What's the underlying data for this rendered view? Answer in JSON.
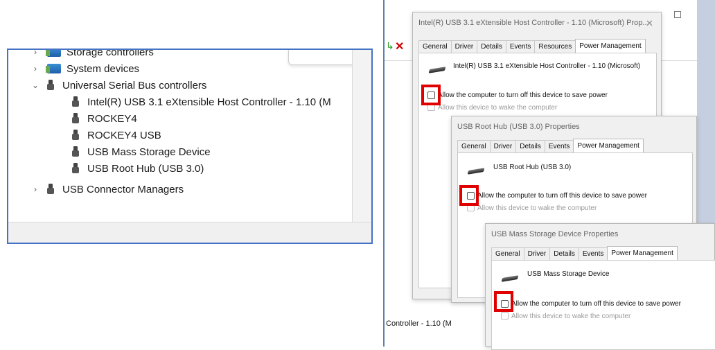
{
  "device_manager": {
    "items": [
      {
        "label": "Storage controllers",
        "icon": "storage-controller-icon",
        "chevron": "collapsed"
      },
      {
        "label": "System devices",
        "icon": "system-devices-icon",
        "chevron": "collapsed"
      },
      {
        "label": "Universal Serial Bus controllers",
        "icon": "usb-icon",
        "chevron": "expanded"
      },
      {
        "label": "Intel(R) USB 3.1 eXtensible Host Controller - 1.10 (M",
        "icon": "usb-icon"
      },
      {
        "label": "ROCKEY4",
        "icon": "usb-icon"
      },
      {
        "label": "ROCKEY4 USB",
        "icon": "usb-icon"
      },
      {
        "label": "USB Mass Storage Device",
        "icon": "usb-icon"
      },
      {
        "label": "USB Root Hub (USB 3.0)",
        "icon": "usb-icon"
      },
      {
        "label": "USB Connector Managers",
        "icon": "usb-icon",
        "chevron": "collapsed"
      }
    ]
  },
  "background_window": {
    "delete_icon": "✕",
    "behind_text": "Controller - 1.10 (M"
  },
  "tabs": [
    "General",
    "Driver",
    "Details",
    "Events",
    "Resources",
    "Power Management"
  ],
  "dialogs": [
    {
      "title": "Intel(R) USB 3.1 eXtensible Host Controller - 1.10 (Microsoft) Prop...",
      "device_name": "Intel(R) USB 3.1 eXtensible Host Controller - 1.10 (Microsoft)",
      "tabs": [
        "General",
        "Driver",
        "Details",
        "Events",
        "Resources",
        "Power Management"
      ],
      "active_tab": "Power Management",
      "option_power": "Allow the computer to turn off this device to save power",
      "option_wake": "Allow this device to wake the computer"
    },
    {
      "title": "USB Root Hub (USB 3.0) Properties",
      "device_name": "USB Root Hub (USB 3.0)",
      "tabs": [
        "General",
        "Driver",
        "Details",
        "Events",
        "Power Management"
      ],
      "active_tab": "Power Management",
      "option_power": "Allow the computer to turn off this device to save power",
      "option_wake": "Allow this device to wake the computer"
    },
    {
      "title": "USB Mass Storage Device Properties",
      "device_name": "USB Mass Storage Device",
      "tabs": [
        "General",
        "Driver",
        "Details",
        "Events",
        "Power Management"
      ],
      "active_tab": "Power Management",
      "option_power": "Allow the computer to turn off this device to save power",
      "option_wake": "Allow this device to wake the computer"
    }
  ],
  "colors": {
    "highlight": "#e00000",
    "frame": "#4472c4"
  }
}
